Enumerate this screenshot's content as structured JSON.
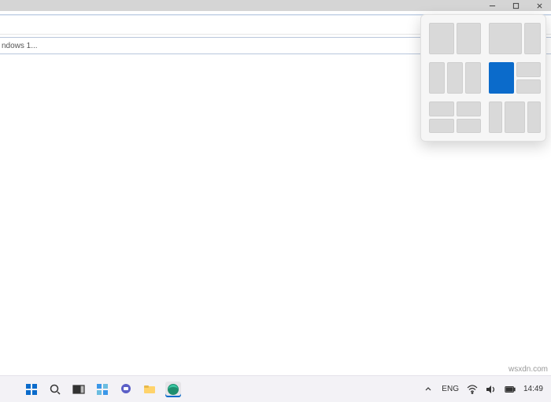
{
  "window_controls": {
    "minimize_name": "minimize",
    "maximize_name": "maximize",
    "close_name": "close"
  },
  "tab": {
    "title_truncated": "ndows 1..."
  },
  "snap_layouts": {
    "name": "Snap Layouts",
    "active_layout_index": 3,
    "active_cell_index": 0
  },
  "taskbar": {
    "start": "Start",
    "search": "Search",
    "taskview": "Task View",
    "widgets": "Widgets",
    "chat": "Chat",
    "explorer": "File Explorer",
    "edge": "Microsoft Edge"
  },
  "systray": {
    "overflow": "Show hidden icons",
    "language": "ENG",
    "wifi": "Wi-Fi",
    "volume": "Volume",
    "battery": "Battery",
    "time": "14:49"
  },
  "watermark": "wsxdn.com"
}
